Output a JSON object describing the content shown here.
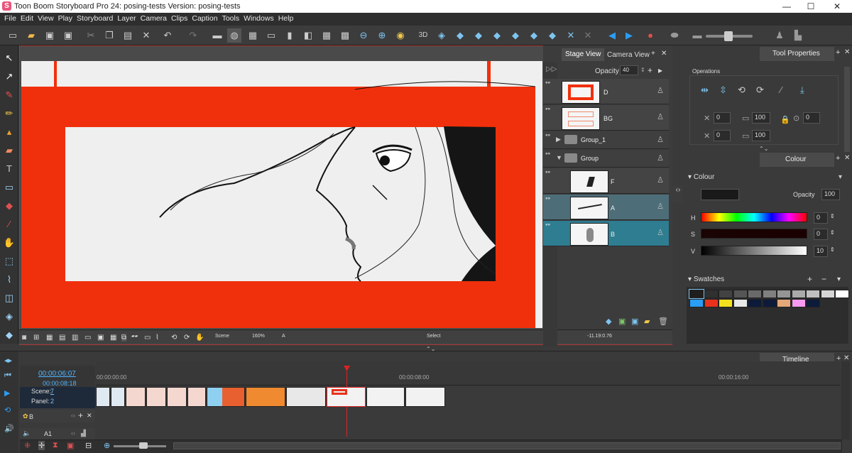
{
  "window": {
    "title": "Toon Boom Storyboard Pro 24: posing-tests Version: posing-tests",
    "logo_letter": "S",
    "controls": [
      "—",
      "☐",
      "✕"
    ]
  },
  "menu": [
    "File",
    "Edit",
    "View",
    "Play",
    "Storyboard",
    "Layer",
    "Camera",
    "Clips",
    "Caption",
    "Tools",
    "Windows",
    "Help"
  ],
  "stage_tabs": {
    "stage": "Stage View",
    "camera": "Camera View"
  },
  "layers_panel": {
    "opacity_label": "Opacity",
    "opacity_value": "40",
    "layers": [
      {
        "name": "D"
      },
      {
        "name": "BG"
      },
      {
        "name": "Group_1"
      },
      {
        "name": "Group"
      },
      {
        "name": "F"
      },
      {
        "name": "A"
      },
      {
        "name": "B"
      }
    ]
  },
  "stage_bar": {
    "scene": "Scene",
    "zoom": "160%",
    "mode": "A",
    "tool": "Select",
    "coords": "-11.19:0.76"
  },
  "tool_properties": {
    "title": "Tool Properties",
    "operations_label": "Operations",
    "x_val": "0",
    "w_val": "100",
    "y_val": "0",
    "h_val": "100",
    "rot_val": "0"
  },
  "colour": {
    "title": "Colour",
    "section": "Colour",
    "opacity_label": "Opacity",
    "opacity_value": "100",
    "h_label": "H",
    "h_value": "0",
    "s_label": "S",
    "s_value": "0",
    "v_label": "V",
    "v_value": "10",
    "current_color": "#1a1a1a",
    "swatches_label": "Swatches",
    "swatches": [
      "#1e1e1e",
      "#303030",
      "#424242",
      "#555555",
      "#6a6a6a",
      "#808080",
      "#959595",
      "#aaaaaa",
      "#c0c0c0",
      "#d5d5d5",
      "#ffffff",
      "#2a9df4",
      "#e8321c",
      "#f2e21e",
      "#e8e8e8",
      "#0d1b3a",
      "#0d1b3a",
      "#e5a878",
      "#f59af0",
      "#0d1b3a"
    ]
  },
  "timeline": {
    "title": "Timeline",
    "current_time": "00:00:06:07",
    "duration": "00:00:08:18",
    "scene_label": "Scene:",
    "scene_value": "7",
    "panel_label": "Panel:",
    "panel_value": "2",
    "ruler": [
      "00:00:00:00",
      "00:00:08:00",
      "00:00:16:00"
    ],
    "track_b": "B",
    "track_a1": "A1"
  },
  "colors": {
    "accent_red": "#f0300c",
    "layer_selected": "#2f7d91",
    "layer_highlight": "#4d6e78"
  }
}
